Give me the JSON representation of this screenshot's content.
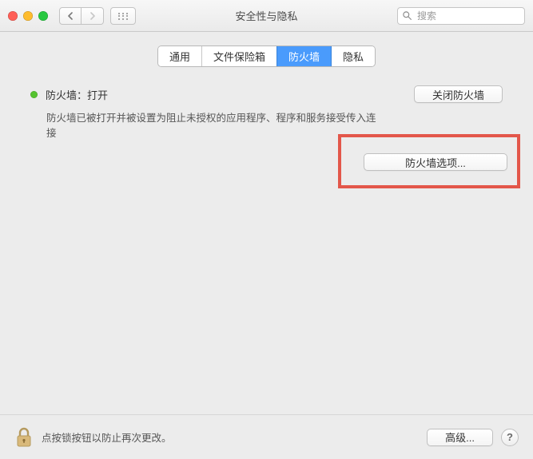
{
  "window": {
    "title": "安全性与隐私"
  },
  "search": {
    "placeholder": "搜索"
  },
  "tabs": {
    "general": "通用",
    "filevault": "文件保险箱",
    "firewall": "防火墙",
    "privacy": "隐私",
    "active": "firewall"
  },
  "firewall": {
    "status_label": "防火墙：打开",
    "disable_button": "关闭防火墙",
    "description": "防火墙已被打开并被设置为阻止未授权的应用程序、程序和服务接受传入连接",
    "options_button": "防火墙选项..."
  },
  "footer": {
    "lock_text": "点按锁按钮以防止再次更改。",
    "advanced_button": "高级...",
    "help": "?"
  }
}
